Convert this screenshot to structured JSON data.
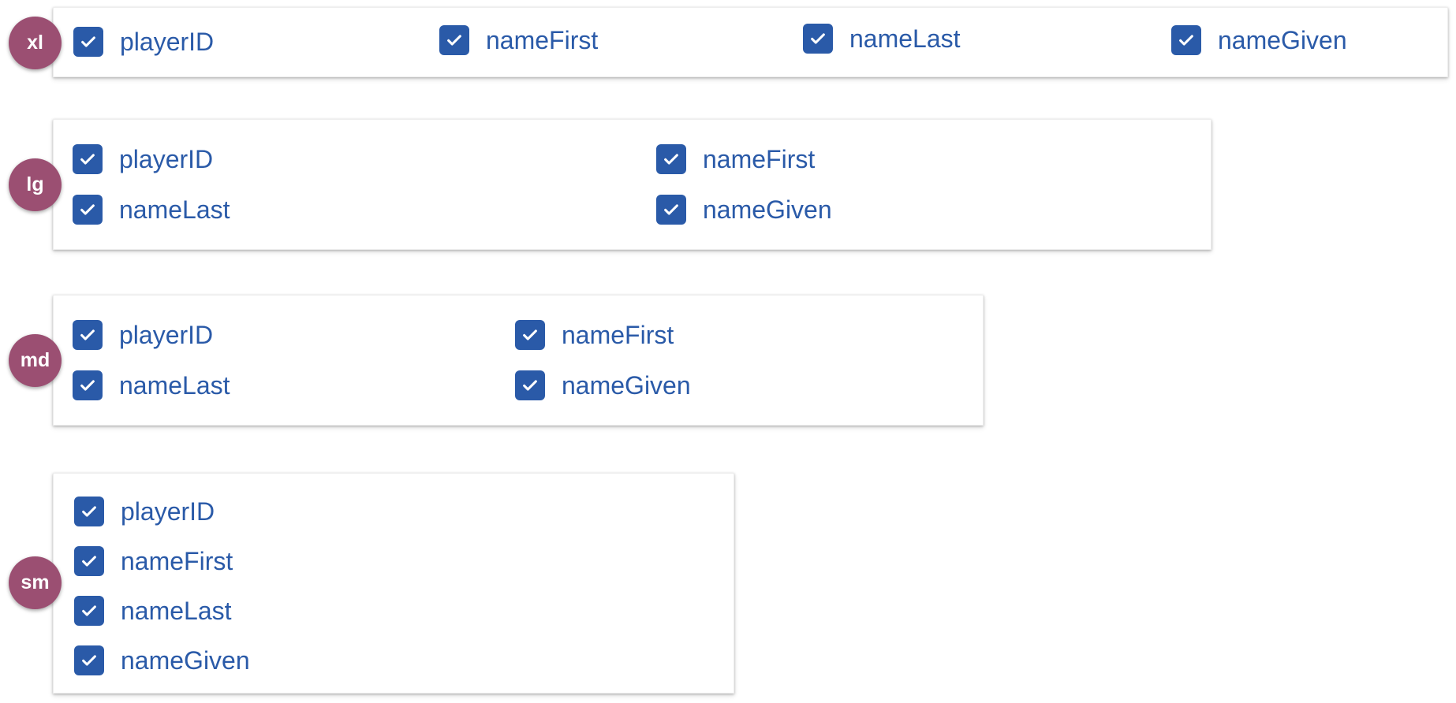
{
  "accent_color": "#2a5aa8",
  "badge_color": "#9b4f72",
  "check_icon": "check-icon",
  "sections": {
    "xl": {
      "badge": "xl",
      "items": [
        {
          "label": "playerID",
          "checked": true
        },
        {
          "label": "nameFirst",
          "checked": true
        },
        {
          "label": "nameLast",
          "checked": true
        },
        {
          "label": "nameGiven",
          "checked": true
        }
      ]
    },
    "lg": {
      "badge": "lg",
      "items": [
        {
          "label": "playerID",
          "checked": true
        },
        {
          "label": "nameFirst",
          "checked": true
        },
        {
          "label": "nameLast",
          "checked": true
        },
        {
          "label": "nameGiven",
          "checked": true
        }
      ]
    },
    "md": {
      "badge": "md",
      "items": [
        {
          "label": "playerID",
          "checked": true
        },
        {
          "label": "nameFirst",
          "checked": true
        },
        {
          "label": "nameLast",
          "checked": true
        },
        {
          "label": "nameGiven",
          "checked": true
        }
      ]
    },
    "sm": {
      "badge": "sm",
      "items": [
        {
          "label": "playerID",
          "checked": true
        },
        {
          "label": "nameFirst",
          "checked": true
        },
        {
          "label": "nameLast",
          "checked": true
        },
        {
          "label": "nameGiven",
          "checked": true
        }
      ]
    }
  }
}
